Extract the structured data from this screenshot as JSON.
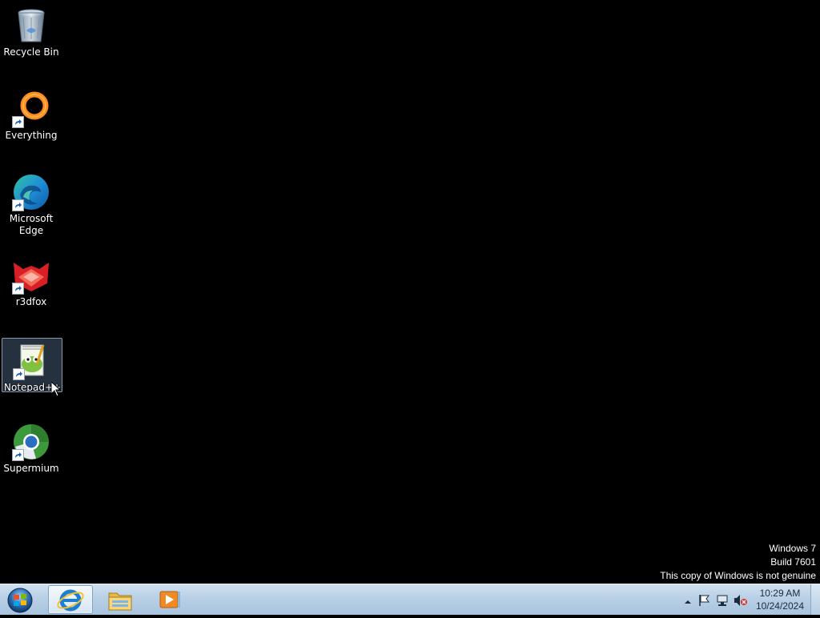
{
  "desktop_icons": [
    {
      "label": "Recycle Bin",
      "icon": "recycle-bin-icon",
      "shortcut": false
    },
    {
      "label": "Everything",
      "icon": "everything-icon",
      "shortcut": true
    },
    {
      "label": "Microsoft Edge",
      "icon": "edge-icon",
      "shortcut": true
    },
    {
      "label": "r3dfox",
      "icon": "r3dfox-icon",
      "shortcut": true
    },
    {
      "label": "Notepad++",
      "icon": "notepad-plus-plus-icon",
      "shortcut": true,
      "selected": true
    },
    {
      "label": "Supermium",
      "icon": "supermium-icon",
      "shortcut": true
    }
  ],
  "watermark": {
    "line1": "Windows 7",
    "line2": "Build 7601",
    "line3": "This copy of Windows is not genuine"
  },
  "taskbar": {
    "start": "windows-start-orb-icon",
    "pinned": [
      {
        "name": "internet-explorer-icon",
        "active": true
      },
      {
        "name": "file-explorer-icon",
        "active": false
      },
      {
        "name": "media-player-icon",
        "active": false
      }
    ],
    "tray_icons": [
      "show-hidden-icons-arrow",
      "action-center-flag-icon",
      "network-icon",
      "volume-muted-icon"
    ],
    "clock": {
      "time": "10:29 AM",
      "date": "10/24/2024"
    }
  },
  "colors": {
    "desktop_bg": "#000000",
    "taskbar_top": "#cfe0f0",
    "taskbar_bottom": "#a9c3de",
    "text_on_desktop": "#ffffff"
  }
}
